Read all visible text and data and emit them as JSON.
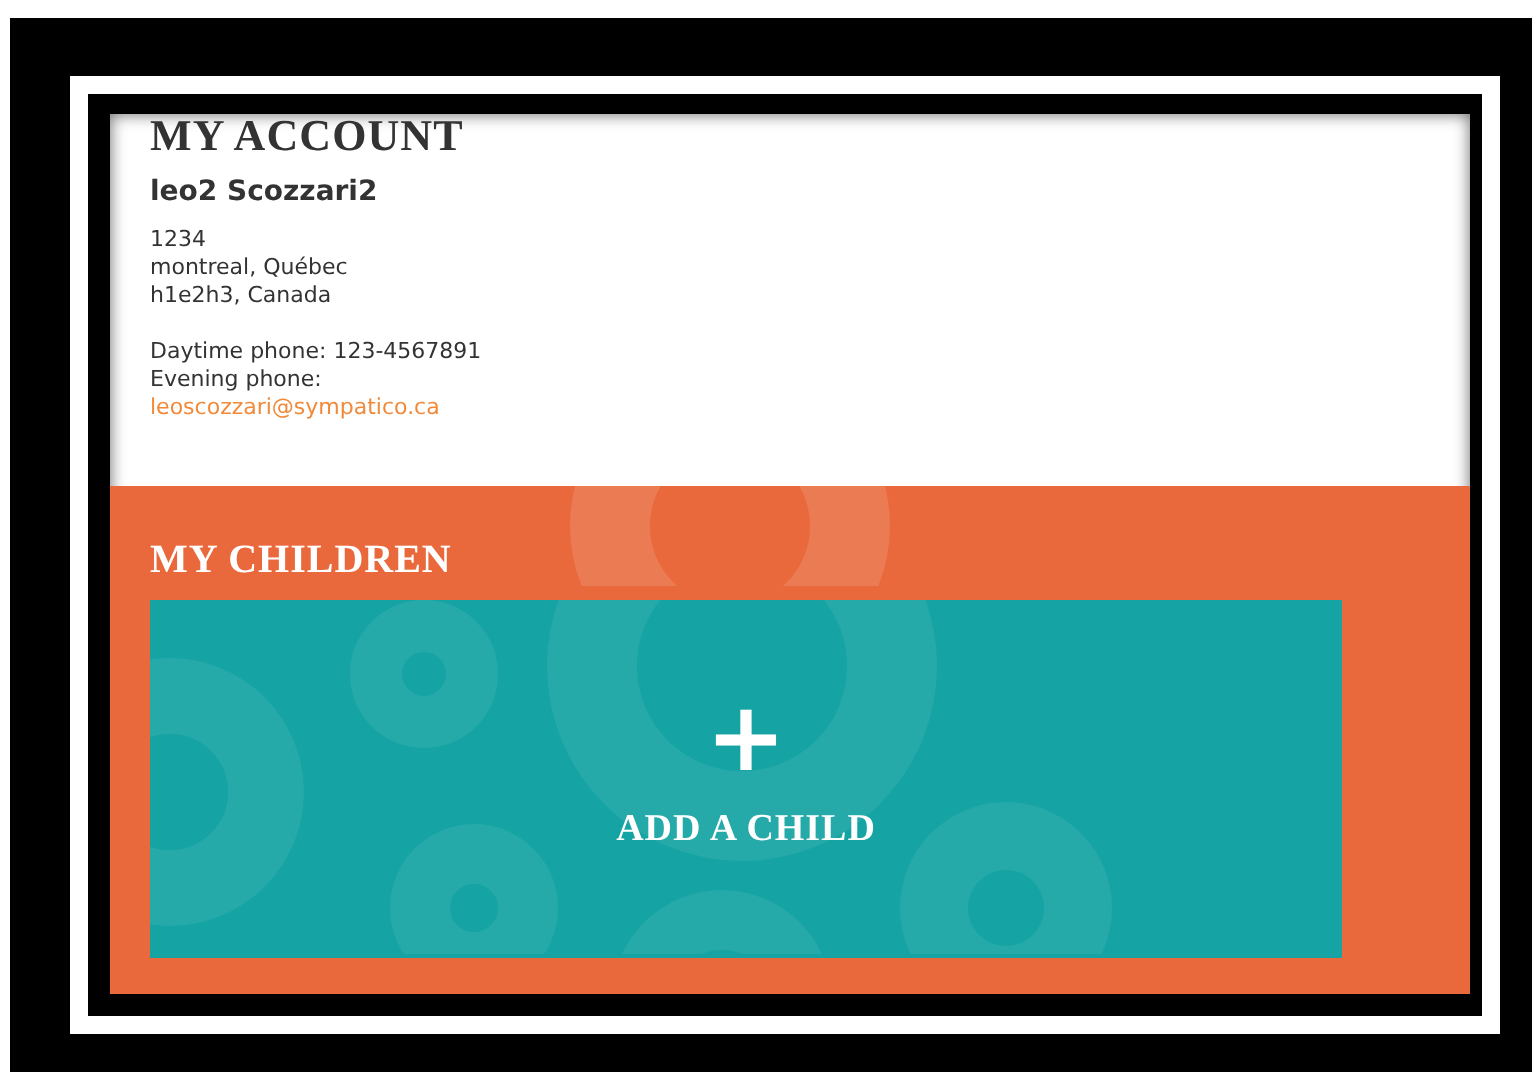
{
  "account": {
    "title": "MY ACCOUNT",
    "name": "leo2 Scozzari2",
    "address_lines": [
      "1234",
      "montreal, Québec",
      "h1e2h3, Canada"
    ],
    "phone_lines": [
      "Daytime phone: 123-4567891",
      "Evening phone:"
    ],
    "email": "leoscozzari@sympatico.ca"
  },
  "children": {
    "title": "MY CHILDREN",
    "add_button": {
      "icon": "+",
      "label": "ADD A CHILD"
    }
  }
}
